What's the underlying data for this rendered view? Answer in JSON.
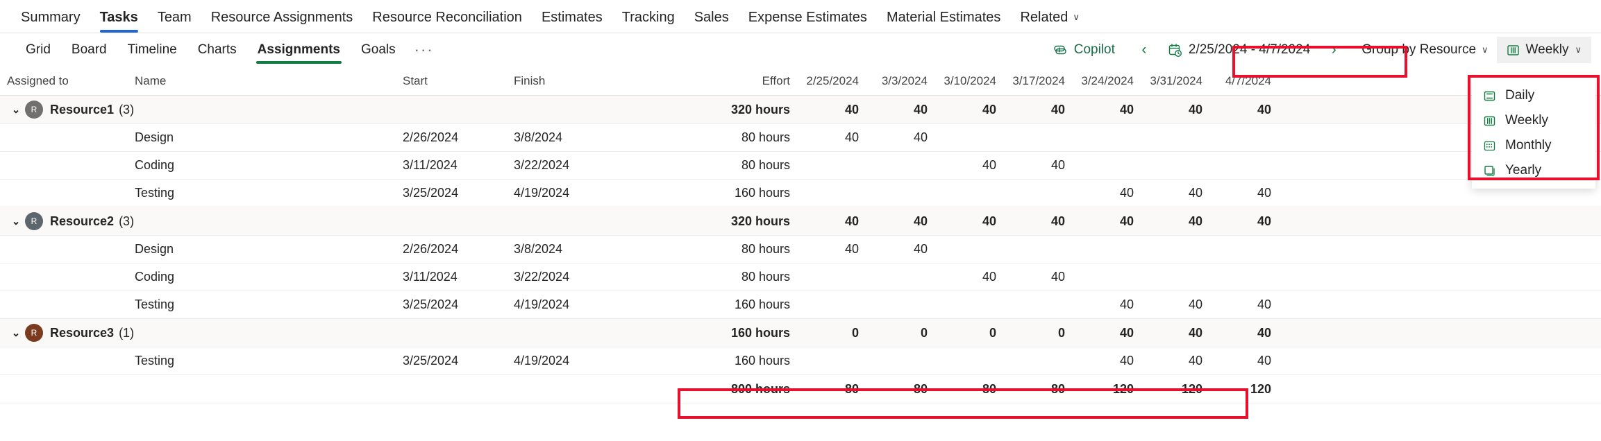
{
  "entity_tabs": [
    {
      "label": "Summary",
      "active": false,
      "caret": false
    },
    {
      "label": "Tasks",
      "active": true,
      "caret": false
    },
    {
      "label": "Team",
      "active": false,
      "caret": false
    },
    {
      "label": "Resource Assignments",
      "active": false,
      "caret": false
    },
    {
      "label": "Resource Reconciliation",
      "active": false,
      "caret": false
    },
    {
      "label": "Estimates",
      "active": false,
      "caret": false
    },
    {
      "label": "Tracking",
      "active": false,
      "caret": false
    },
    {
      "label": "Sales",
      "active": false,
      "caret": false
    },
    {
      "label": "Expense Estimates",
      "active": false,
      "caret": false
    },
    {
      "label": "Material Estimates",
      "active": false,
      "caret": false
    },
    {
      "label": "Related",
      "active": false,
      "caret": true
    }
  ],
  "view_tabs": [
    {
      "label": "Grid",
      "active": false
    },
    {
      "label": "Board",
      "active": false
    },
    {
      "label": "Timeline",
      "active": false
    },
    {
      "label": "Charts",
      "active": false
    },
    {
      "label": "Assignments",
      "active": true
    },
    {
      "label": "Goals",
      "active": false
    }
  ],
  "overflow_label": "···",
  "toolbar": {
    "copilot_label": "Copilot",
    "prev_arrow": "‹",
    "next_arrow": "›",
    "date_range": "2/25/2024 - 4/7/2024",
    "group_by_label": "Group by Resource",
    "scale_label": "Weekly",
    "chevron": "∨"
  },
  "scale_menu": {
    "items": [
      {
        "label": "Daily",
        "icon": "day-view-icon"
      },
      {
        "label": "Weekly",
        "icon": "week-view-icon"
      },
      {
        "label": "Monthly",
        "icon": "month-view-icon"
      },
      {
        "label": "Yearly",
        "icon": "year-view-icon"
      }
    ]
  },
  "grid": {
    "columns": {
      "assigned_to": "Assigned to",
      "name": "Name",
      "start": "Start",
      "finish": "Finish",
      "effort": "Effort"
    },
    "week_columns": [
      "2/25/2024",
      "3/3/2024",
      "3/10/2024",
      "3/17/2024",
      "3/24/2024",
      "3/31/2024",
      "4/7/2024"
    ],
    "groups": [
      {
        "name": "Resource1",
        "count": "(3)",
        "initial": "R",
        "avatar_color": "#707070",
        "effort": "320 hours",
        "weeks": [
          "40",
          "40",
          "40",
          "40",
          "40",
          "40",
          "40"
        ],
        "tasks": [
          {
            "name": "Design",
            "start": "2/26/2024",
            "finish": "3/8/2024",
            "effort": "80 hours",
            "weeks": [
              "40",
              "40",
              "",
              "",
              "",
              "",
              ""
            ]
          },
          {
            "name": "Coding",
            "start": "3/11/2024",
            "finish": "3/22/2024",
            "effort": "80 hours",
            "weeks": [
              "",
              "",
              "40",
              "40",
              "",
              "",
              ""
            ]
          },
          {
            "name": "Testing",
            "start": "3/25/2024",
            "finish": "4/19/2024",
            "effort": "160 hours",
            "weeks": [
              "",
              "",
              "",
              "",
              "40",
              "40",
              "40"
            ]
          }
        ]
      },
      {
        "name": "Resource2",
        "count": "(3)",
        "initial": "R",
        "avatar_color": "#5d666d",
        "effort": "320 hours",
        "weeks": [
          "40",
          "40",
          "40",
          "40",
          "40",
          "40",
          "40"
        ],
        "tasks": [
          {
            "name": "Design",
            "start": "2/26/2024",
            "finish": "3/8/2024",
            "effort": "80 hours",
            "weeks": [
              "40",
              "40",
              "",
              "",
              "",
              "",
              ""
            ]
          },
          {
            "name": "Coding",
            "start": "3/11/2024",
            "finish": "3/22/2024",
            "effort": "80 hours",
            "weeks": [
              "",
              "",
              "40",
              "40",
              "",
              "",
              ""
            ]
          },
          {
            "name": "Testing",
            "start": "3/25/2024",
            "finish": "4/19/2024",
            "effort": "160 hours",
            "weeks": [
              "",
              "",
              "",
              "",
              "40",
              "40",
              "40"
            ]
          }
        ]
      },
      {
        "name": "Resource3",
        "count": "(1)",
        "initial": "R",
        "avatar_color": "#7a3b1e",
        "effort": "160 hours",
        "weeks": [
          "0",
          "0",
          "0",
          "0",
          "40",
          "40",
          "40"
        ],
        "tasks": [
          {
            "name": "Testing",
            "start": "3/25/2024",
            "finish": "4/19/2024",
            "effort": "160 hours",
            "weeks": [
              "",
              "",
              "",
              "",
              "40",
              "40",
              "40"
            ]
          }
        ]
      }
    ],
    "total_row": {
      "effort": "800 hours",
      "weeks": [
        "80",
        "80",
        "80",
        "80",
        "120",
        "120",
        "120"
      ]
    }
  },
  "colors": {
    "tab_accent": "#2266cc",
    "view_accent": "#107c41",
    "annotation": "#e8112d",
    "copilot": "#1b6b4a"
  }
}
